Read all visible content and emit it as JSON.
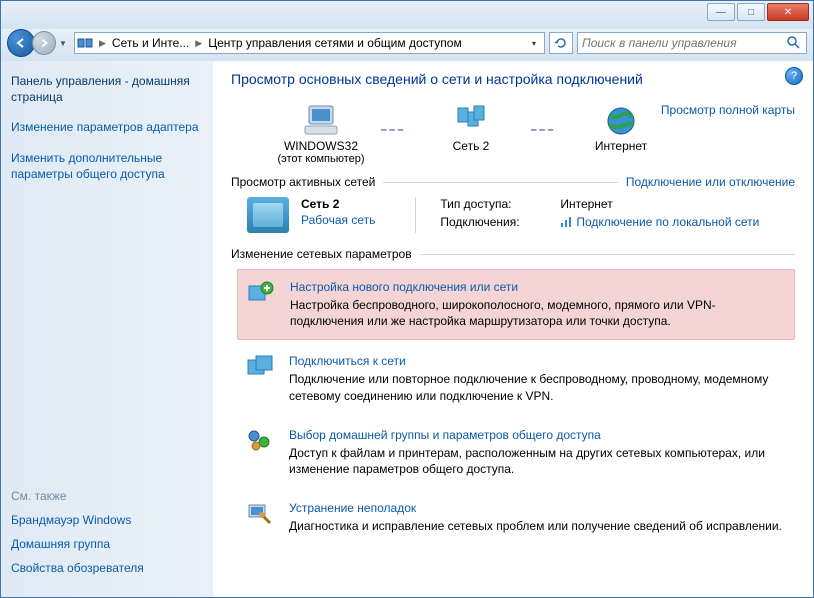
{
  "titlebar": {
    "min": "—",
    "max": "□",
    "close": "✕"
  },
  "address": {
    "seg1": "Сеть и Инте...",
    "seg2": "Центр управления сетями и общим доступом"
  },
  "search": {
    "placeholder": "Поиск в панели управления"
  },
  "sidebar": {
    "home": "Панель управления - домашняя страница",
    "link1": "Изменение параметров адаптера",
    "link2": "Изменить дополнительные параметры общего доступа",
    "also_label": "См. также",
    "also1": "Брандмауэр Windows",
    "also2": "Домашняя группа",
    "also3": "Свойства обозревателя"
  },
  "main": {
    "heading": "Просмотр основных сведений о сети и настройка подключений",
    "full_map": "Просмотр полной карты",
    "node1": "WINDOWS32",
    "node1_sub": "(этот компьютер)",
    "node2": "Сеть  2",
    "node3": "Интернет",
    "section_active": "Просмотр активных сетей",
    "connect_disconnect": "Подключение или отключение",
    "net_name": "Сеть  2",
    "net_type": "Рабочая сеть",
    "access_key": "Тип доступа:",
    "access_val": "Интернет",
    "conn_key": "Подключения:",
    "conn_val": "Подключение по локальной сети",
    "section_change": "Изменение сетевых параметров",
    "task1_title": "Настройка нового подключения или сети",
    "task1_desc": "Настройка беспроводного, широкополосного, модемного, прямого или VPN-подключения или же настройка маршрутизатора или точки доступа.",
    "task2_title": "Подключиться к сети",
    "task2_desc": "Подключение или повторное подключение к беспроводному, проводному, модемному сетевому соединению или подключение к VPN.",
    "task3_title": "Выбор домашней группы и параметров общего доступа",
    "task3_desc": "Доступ к файлам и принтерам, расположенным на других сетевых компьютерах, или изменение параметров общего доступа.",
    "task4_title": "Устранение неполадок",
    "task4_desc": "Диагностика и исправление сетевых проблем или получение сведений об исправлении."
  }
}
